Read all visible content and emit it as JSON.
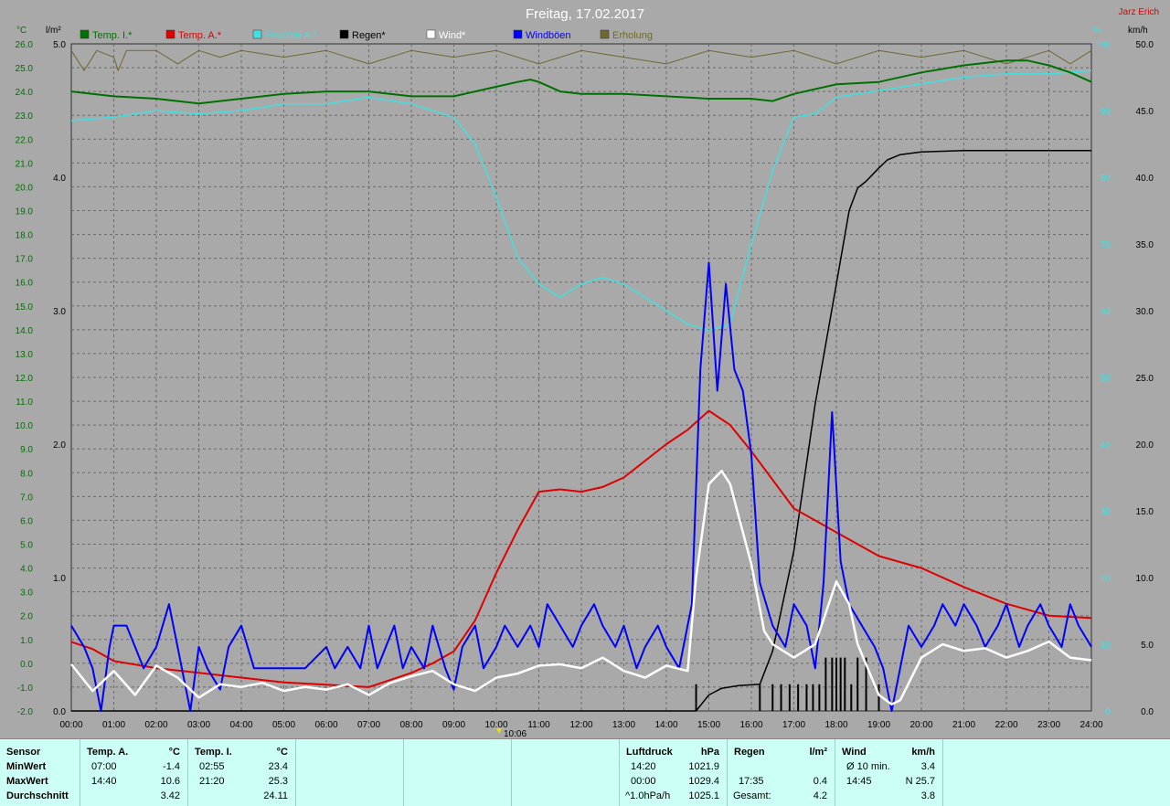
{
  "title": "Freitag, 17.02.2017",
  "author": "Jarz Erich",
  "axes": {
    "left_unit_1": "°C",
    "left_unit_2": "l/m²",
    "right_unit_1": "%",
    "right_unit_2": "km/h",
    "time_marker": "10:06"
  },
  "legend": [
    {
      "label": "Temp. I.*",
      "color": "#007000"
    },
    {
      "label": "Temp. A.*",
      "color": "#e00000"
    },
    {
      "label": "Feuchte A.*",
      "color": "#40e0e0"
    },
    {
      "label": "Regen*",
      "color": "#000000"
    },
    {
      "label": "Wind*",
      "color": "#ffffff"
    },
    {
      "label": "Windböen",
      "color": "#0000ff"
    },
    {
      "label": "Erholung",
      "color": "#706830"
    }
  ],
  "chart_data": {
    "type": "line",
    "title": "Freitag, 17.02.2017",
    "x_labels": [
      "00:00",
      "01:00",
      "02:00",
      "03:00",
      "04:00",
      "05:00",
      "06:00",
      "07:00",
      "08:00",
      "09:00",
      "10:00",
      "11:00",
      "12:00",
      "13:00",
      "14:00",
      "15:00",
      "16:00",
      "17:00",
      "18:00",
      "19:00",
      "20:00",
      "21:00",
      "22:00",
      "23:00",
      "24:00"
    ],
    "temp_ticks": [
      "26.0",
      "25.0",
      "24.0",
      "23.0",
      "22.0",
      "21.0",
      "20.0",
      "19.0",
      "18.0",
      "17.0",
      "16.0",
      "15.0",
      "14.0",
      "13.0",
      "12.0",
      "11.0",
      "10.0",
      "9.0",
      "8.0",
      "7.0",
      "6.0",
      "5.0",
      "4.0",
      "3.0",
      "2.0",
      "1.0",
      "0.0",
      "-1.0",
      "-2.0"
    ],
    "rain_ticks": [
      "5.0",
      "4.0",
      "3.0",
      "2.0",
      "1.0",
      "0.0"
    ],
    "humidity_ticks": [
      "100",
      "90",
      "80",
      "70",
      "60",
      "50",
      "40",
      "30",
      "20",
      "10",
      "0"
    ],
    "wind_ticks": [
      "50.0",
      "45.0",
      "40.0",
      "35.0",
      "30.0",
      "25.0",
      "20.0",
      "15.0",
      "10.0",
      "5.0",
      "0.0"
    ],
    "ylim_temp": [
      -2,
      26
    ],
    "ylim_rain": [
      0,
      5
    ],
    "ylim_humidity": [
      0,
      100
    ],
    "ylim_wind": [
      0,
      50
    ],
    "grid": true,
    "series": [
      {
        "name": "Temp. I.*",
        "axis": "temp",
        "color": "#007000",
        "x": [
          0,
          1,
          2,
          3,
          4,
          5,
          6,
          7,
          8,
          9,
          9.5,
          10,
          10.5,
          10.8,
          11,
          11.5,
          12,
          13,
          14,
          15,
          16,
          16.5,
          17,
          17.5,
          18,
          19,
          20,
          21,
          22,
          22.5,
          23,
          23.5,
          24
        ],
        "y": [
          24.0,
          23.8,
          23.7,
          23.5,
          23.7,
          23.9,
          24.0,
          24.0,
          23.8,
          23.8,
          24.0,
          24.2,
          24.4,
          24.5,
          24.4,
          24.0,
          23.9,
          23.9,
          23.8,
          23.7,
          23.7,
          23.6,
          23.9,
          24.1,
          24.3,
          24.4,
          24.8,
          25.1,
          25.3,
          25.3,
          25.1,
          24.8,
          24.4
        ]
      },
      {
        "name": "Temp. A.*",
        "axis": "temp",
        "color": "#e00000",
        "x": [
          0,
          0.5,
          1,
          2,
          3,
          4,
          5,
          6,
          7,
          8,
          8.5,
          9,
          9.5,
          10,
          10.5,
          11,
          11.5,
          12,
          12.5,
          13,
          14,
          14.5,
          15,
          15.5,
          16,
          17,
          18,
          19,
          20,
          21,
          22,
          23,
          24
        ],
        "y": [
          0.9,
          0.6,
          0.1,
          -0.2,
          -0.4,
          -0.6,
          -0.8,
          -0.9,
          -1.0,
          -0.4,
          0.0,
          0.5,
          1.8,
          3.8,
          5.6,
          7.2,
          7.3,
          7.2,
          7.4,
          7.8,
          9.2,
          9.8,
          10.6,
          10.0,
          8.9,
          6.5,
          5.5,
          4.5,
          4.0,
          3.2,
          2.5,
          2.0,
          1.9
        ]
      },
      {
        "name": "Feuchte A.*",
        "axis": "humidity",
        "color": "#40e0e0",
        "x": [
          0,
          1,
          2,
          3,
          4,
          5,
          6,
          7,
          8,
          9,
          9.5,
          10,
          10.5,
          11,
          11.5,
          12,
          12.5,
          13,
          14,
          14.5,
          15,
          15.5,
          16,
          16.5,
          17,
          17.5,
          18,
          19,
          20,
          21,
          22,
          23,
          24
        ],
        "y": [
          88.5,
          89.0,
          90,
          89.5,
          90,
          91,
          91,
          92,
          91,
          89,
          85,
          77,
          68,
          64,
          62,
          64,
          65,
          64,
          60,
          58,
          57,
          58,
          70,
          81,
          89,
          89.5,
          92,
          93,
          94,
          95,
          95.5,
          95.5,
          96
        ]
      },
      {
        "name": "Regen*",
        "axis": "rain",
        "color": "#000000",
        "x": [
          0,
          14.7,
          15,
          15.3,
          15.7,
          16.2,
          16.5,
          17,
          17.5,
          18,
          18.3,
          18.5,
          18.7,
          19,
          19.2,
          19.5,
          20,
          21,
          22,
          23,
          24
        ],
        "y": [
          0,
          0,
          0.12,
          0.17,
          0.19,
          0.2,
          0.45,
          1.2,
          2.3,
          3.2,
          3.75,
          3.92,
          3.97,
          4.07,
          4.13,
          4.17,
          4.19,
          4.2,
          4.2,
          4.2,
          4.2
        ]
      },
      {
        "name": "Wind*",
        "axis": "wind",
        "color": "#ffffff",
        "x": [
          0,
          0.5,
          1,
          1.5,
          2,
          2.5,
          3,
          3.5,
          4,
          4.5,
          5,
          5.5,
          6,
          6.5,
          7,
          7.5,
          8,
          8.5,
          9,
          9.5,
          10,
          10.5,
          11,
          11.5,
          12,
          12.5,
          13,
          13.5,
          14,
          14.5,
          14.7,
          15,
          15.3,
          15.5,
          16,
          16.3,
          16.5,
          17,
          17.5,
          18,
          18.3,
          18.5,
          19,
          19.3,
          19.5,
          20,
          20.5,
          21,
          21.5,
          22,
          22.5,
          23,
          23.5,
          24
        ],
        "y": [
          3.5,
          1.5,
          3,
          1.2,
          3.4,
          2.5,
          1,
          2,
          1.8,
          2.1,
          1.5,
          1.8,
          1.6,
          2,
          1.2,
          2.1,
          2.6,
          3,
          2,
          1.5,
          2.5,
          2.8,
          3.4,
          3.5,
          3.2,
          4,
          3,
          2.5,
          3.4,
          3,
          10,
          17,
          18,
          17,
          11,
          6,
          5,
          4,
          5,
          9.7,
          8,
          5,
          1.2,
          0.5,
          0.8,
          4,
          5,
          4.5,
          4.7,
          4,
          4.5,
          5.2,
          4,
          3.8
        ]
      },
      {
        "name": "Windböen",
        "axis": "wind",
        "color": "#0000ff",
        "x": [
          0,
          0.3,
          0.5,
          0.7,
          0.9,
          1.0,
          1.3,
          1.5,
          1.7,
          2.0,
          2.3,
          2.5,
          2.8,
          3.0,
          3.2,
          3.5,
          3.7,
          4.0,
          4.3,
          4.5,
          5.0,
          5.5,
          6.0,
          6.2,
          6.5,
          6.8,
          7.0,
          7.2,
          7.4,
          7.6,
          7.8,
          8.0,
          8.3,
          8.5,
          8.8,
          9.0,
          9.2,
          9.5,
          9.7,
          10.0,
          10.2,
          10.5,
          10.8,
          11.0,
          11.2,
          11.5,
          11.8,
          12.0,
          12.3,
          12.5,
          12.8,
          13.0,
          13.3,
          13.5,
          13.8,
          14.0,
          14.3,
          14.6,
          14.8,
          15.0,
          15.2,
          15.4,
          15.6,
          15.8,
          16.0,
          16.2,
          16.5,
          16.8,
          17.0,
          17.3,
          17.5,
          17.7,
          17.9,
          18.1,
          18.3,
          18.6,
          18.9,
          19.1,
          19.3,
          19.5,
          19.7,
          20.0,
          20.3,
          20.5,
          20.8,
          21.0,
          21.3,
          21.5,
          21.8,
          22.0,
          22.3,
          22.5,
          22.8,
          23.0,
          23.3,
          23.5,
          23.7,
          24.0
        ],
        "y": [
          6.4,
          4.8,
          3.2,
          0,
          4.8,
          6.4,
          6.4,
          4.8,
          3.2,
          4.8,
          8.0,
          4.8,
          0,
          4.8,
          3.2,
          1.6,
          4.8,
          6.4,
          3.2,
          3.2,
          3.2,
          3.2,
          4.8,
          3.2,
          4.8,
          3.2,
          6.4,
          3.2,
          4.8,
          6.4,
          3.2,
          4.8,
          3.2,
          6.4,
          3.2,
          1.6,
          4.8,
          6.4,
          3.2,
          4.8,
          6.4,
          4.8,
          6.4,
          4.8,
          8.0,
          6.4,
          4.8,
          6.4,
          8.0,
          6.4,
          4.8,
          6.4,
          3.2,
          4.8,
          6.4,
          4.8,
          3.2,
          8.0,
          25.6,
          33.6,
          24.0,
          32.0,
          25.6,
          24.0,
          19.2,
          9.6,
          6.4,
          4.8,
          8.0,
          6.4,
          3.2,
          9.6,
          22.4,
          11.2,
          8.0,
          6.4,
          4.8,
          3.2,
          0,
          3.2,
          6.4,
          4.8,
          6.4,
          8.0,
          6.4,
          8.0,
          6.4,
          4.8,
          6.4,
          8.0,
          4.8,
          6.4,
          8.0,
          6.4,
          4.8,
          8.0,
          6.4,
          4.8
        ]
      },
      {
        "name": "Erholung",
        "axis": "humidity",
        "color": "#706830",
        "x": [
          0,
          0.3,
          0.6,
          1.0,
          1.1,
          1.3,
          2.0,
          2.5,
          3.0,
          3.5,
          4.0,
          5.0,
          6.0,
          7.0,
          8.0,
          9.0,
          10.0,
          11.0,
          12.0,
          13.0,
          14.0,
          15.0,
          16.0,
          17.0,
          18.0,
          19.0,
          20.0,
          21.0,
          22.0,
          23.0,
          23.5,
          24.0
        ],
        "y": [
          99,
          96,
          99,
          98,
          96,
          99,
          99,
          97,
          99,
          98,
          99,
          98,
          99,
          97,
          99,
          98,
          99,
          97,
          99,
          98,
          97,
          99,
          98,
          99,
          97,
          99,
          98,
          99,
          97,
          99,
          97,
          99
        ]
      }
    ],
    "rain_bars_x": [
      14.7,
      16.2,
      16.5,
      16.7,
      16.9,
      17.1,
      17.3,
      17.45,
      17.6,
      17.75,
      17.9,
      18.0,
      18.1,
      18.2,
      18.35,
      18.5,
      18.7,
      19.0
    ],
    "rain_bars_h": [
      0.2,
      0.2,
      0.2,
      0.2,
      0.2,
      0.2,
      0.2,
      0.2,
      0.2,
      0.4,
      0.4,
      0.4,
      0.4,
      0.4,
      0.2,
      0.4,
      0.4,
      0.2
    ]
  },
  "panel": {
    "sensor": {
      "header": "Sensor",
      "rows": [
        "MinWert",
        "MaxWert",
        "Durchschnitt"
      ]
    },
    "temp_a": {
      "header": "Temp. A.",
      "unit": "°C",
      "t1": "07:00",
      "v1": "-1.4",
      "t2": "14:40",
      "v2": "10.6",
      "v3": "3.42"
    },
    "temp_i": {
      "header": "Temp. I.",
      "unit": "°C",
      "t1": "02:55",
      "v1": "23.4",
      "t2": "21:20",
      "v2": "25.3",
      "v3": "24.11"
    },
    "pressure": {
      "header": "Luftdruck",
      "unit": "hPa",
      "t1": "14:20",
      "v1": "1021.9",
      "t2": "00:00",
      "v2": "1029.4",
      "t3": "^1.0hPa/h",
      "v3": "1025.1"
    },
    "rain": {
      "header": "Regen",
      "unit": "l/m²",
      "t2": "17:35",
      "v2": "0.4",
      "t3": "Gesamt:",
      "v3": "4.2"
    },
    "wind": {
      "header": "Wind",
      "unit": "km/h",
      "t1": "Ø 10 min.",
      "v1": "3.4",
      "t2": "14:45",
      "v2": "N 25.7",
      "v3": "3.8"
    }
  }
}
